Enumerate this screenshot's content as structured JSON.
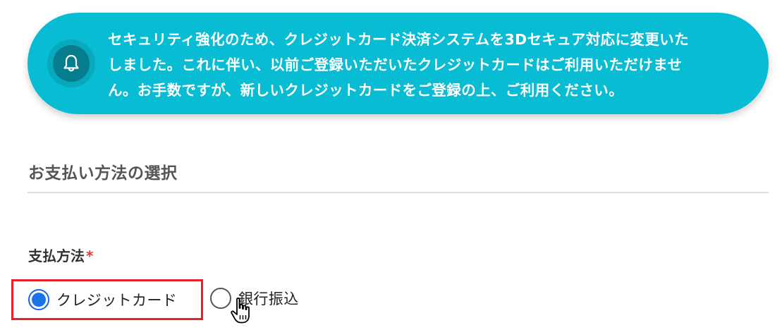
{
  "notice": {
    "icon": "bell-icon",
    "background": "#07bcd3",
    "lines": [
      "セキュリティ強化のため、クレジットカード決済システムを3Dセキュア対応に変更いた",
      "しました。これに伴い、以前ご登録いただいたクレジットカードはご利用いただけませ",
      "ん。お手数ですが、新しいクレジットカードをご登録の上、ご利用ください。"
    ]
  },
  "section": {
    "title": "お支払い方法の選択"
  },
  "payment_field": {
    "label": "支払方法",
    "required_mark": "*",
    "options": [
      {
        "label": "クレジットカード",
        "selected": true
      },
      {
        "label": "銀行振込",
        "selected": false
      }
    ],
    "accent_color": "#1a73e8",
    "highlight_color": "#e8202a"
  }
}
